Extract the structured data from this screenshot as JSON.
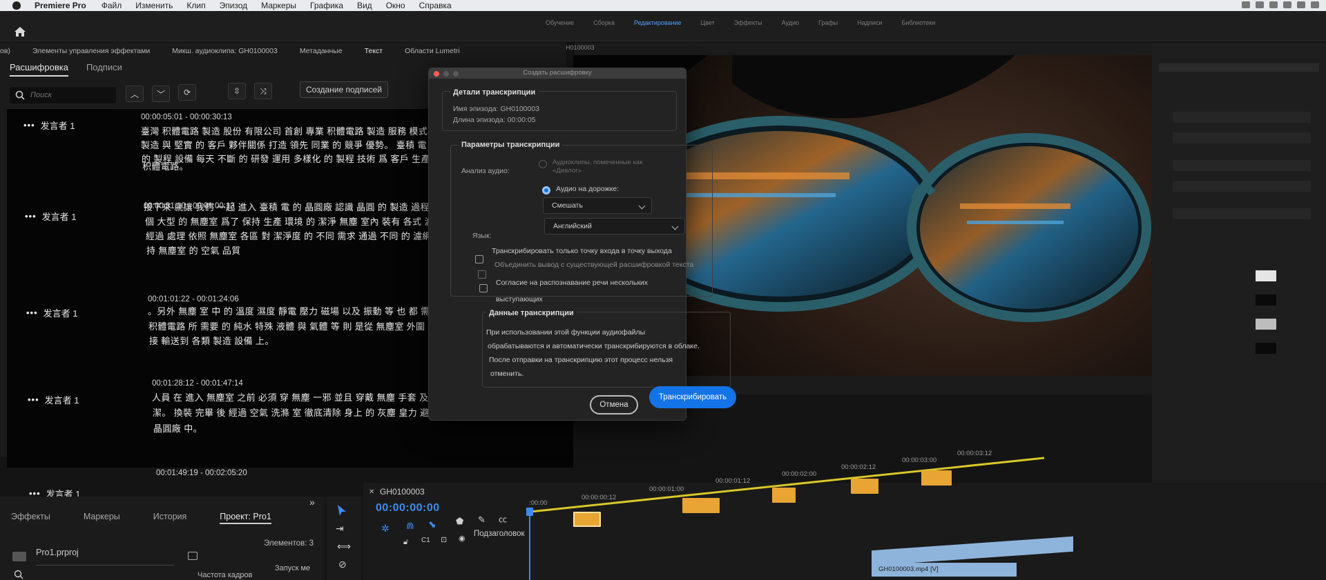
{
  "menubar": {
    "app": "Premiere Pro",
    "items": [
      "Файл",
      "Изменить",
      "Клип",
      "Эпизод",
      "Маркеры",
      "Графика",
      "Вид",
      "Окно",
      "Справка"
    ]
  },
  "workspace_tabs": [
    "Обучение",
    "Сборка",
    "Редактирование",
    "Цвет",
    "Эффекты",
    "Аудио",
    "Графы",
    "Надписи",
    "Библиотеки"
  ],
  "panel_tabs": [
    "ов)",
    "Элементы управления эффектами",
    "Микш. аудиоклипа: GH0100003",
    "Метаданные",
    "Текст",
    "Области Lumetri"
  ],
  "text_panel": {
    "tab_transcript": "Расшифровка",
    "tab_captions": "Подписи",
    "search_placeholder": "Поиск",
    "create_captions": "Создание подписей",
    "segments": [
      {
        "speaker": "发言者 1",
        "timecode": "00:00:05:01 - 00:00:30:13",
        "lines": [
          "臺灣 积體電路 製造 股份 有限公司 首創 專業 积體電路 製造 服務 模式 以 專",
          "製造 與 堅實 的 客戶 夥伴關係 打造 領先 同業 的 競爭 優勢。 臺積 電 的 品",
          "的 製程 設備 每天 不斷 的 研發 運用 多樣化 的 製程 技術 爲 客戶 生產 各種",
          "积體電路。"
        ]
      },
      {
        "speaker": "发言者 1",
        "timecode": "00:00:31:10 - 00:01:00:13",
        "lines": [
          "接下來 就讓 我們 一起 進入 臺積 電 的 晶圓廠 認識 晶圓 的 製造 過程。 整",
          "個 大型 的 無塵室 爲了 保持 生產 環境 的 潔淨 無塵 室內 裝有 各式 濾網 久",
          "經過 處理 依照 無塵室 各區 對 潔淨度 的 不同 需求 通過 不同 的 濾網 去除",
          "持 無塵室 的 空氣 品質"
        ]
      },
      {
        "speaker": "发言者 1",
        "timecode": "00:01:01:22 - 00:01:24:06",
        "lines": [
          "。另外 無塵 室 中 的 溫度 濕度 靜電 壓力 磁場 以及 振動 等 也 都 需要 被",
          "积體電路 所 需要 的 純水 特殊 液體 與 氣體 等 則 是從 無塵室 外圍 透過 管",
          "接 輸送到 各類 製造 設備 上。"
        ]
      },
      {
        "speaker": "发言者 1",
        "timecode": "00:01:28:12 - 00:01:47:14",
        "lines": [
          "人員 在 進入 無塵室 之前 必須 穿 無塵 一邪 並且 穿戴 無塵 手套 及 口罩 以",
          "潔。 換裝 完畢 後 經過 空氣 洗滌 室 徹底清除 身上 的 灰塵 皇力 避免 將",
          "晶圓廠 中。"
        ]
      },
      {
        "speaker": "发言者 1",
        "timecode": "00:01:49:19 - 00:02:05:20",
        "lines": []
      }
    ]
  },
  "program_monitor": {
    "title": "Программа: GH0100003"
  },
  "dialog": {
    "title": "Создать расшифровку",
    "details_title": "Детали транскрипции",
    "episode_name": "Имя эпизода: GH0100003",
    "episode_length": "Длина эпизода: 00:00:05",
    "params_title": "Параметры транскрипции",
    "audio_label": "Анализ аудио:",
    "audio_opt1": "Аудиоклипы, помеченные как «Диалог»",
    "audio_opt2": "Аудио на дорожке:",
    "mix_value": "Смешать",
    "lang_label": "Язык:",
    "lang_value": "Английский",
    "check1": "Транскрибировать только точку входа в точку выхода",
    "check2": "Объединить вывод с существующей расшифровкой текста",
    "check3": "Согласие на распознавание речи нескольких выступающих",
    "data_title": "Данные транскрипции",
    "data_text": [
      "При использовании этой функции аудиофайлы",
      "обрабатываются и автоматически транскрибируются в облаке.",
      "После отправки на транскрипцию этот процесс нельзя",
      "отменить."
    ],
    "cancel": "Отмена",
    "transcribe": "Транскрибировать"
  },
  "project_panel": {
    "tabs": [
      "Эффекты",
      "Маркеры",
      "История",
      "Проект: Pro1"
    ],
    "file": "Pro1.prproj",
    "count": "Элементов: 3",
    "col_fps": "Частота кадров",
    "col_start": "Запуск ме"
  },
  "timeline": {
    "sequence": "GH0100003",
    "timecode": "00:00:00:00",
    "ruler": [
      ":00:00",
      "00:00:00:12",
      "00:00:01:00",
      "00:00:01:12",
      "00:00:02:00",
      "00:00:02:12",
      "00:00:03:00",
      "00:00:03:12"
    ],
    "track_label": "Подзаголовок",
    "clip": "GH0100003.mp4 [V]",
    "colors": {
      "accent": "#1473e6",
      "marker": "#e8a534",
      "playhead": "#3c8cf0"
    }
  }
}
